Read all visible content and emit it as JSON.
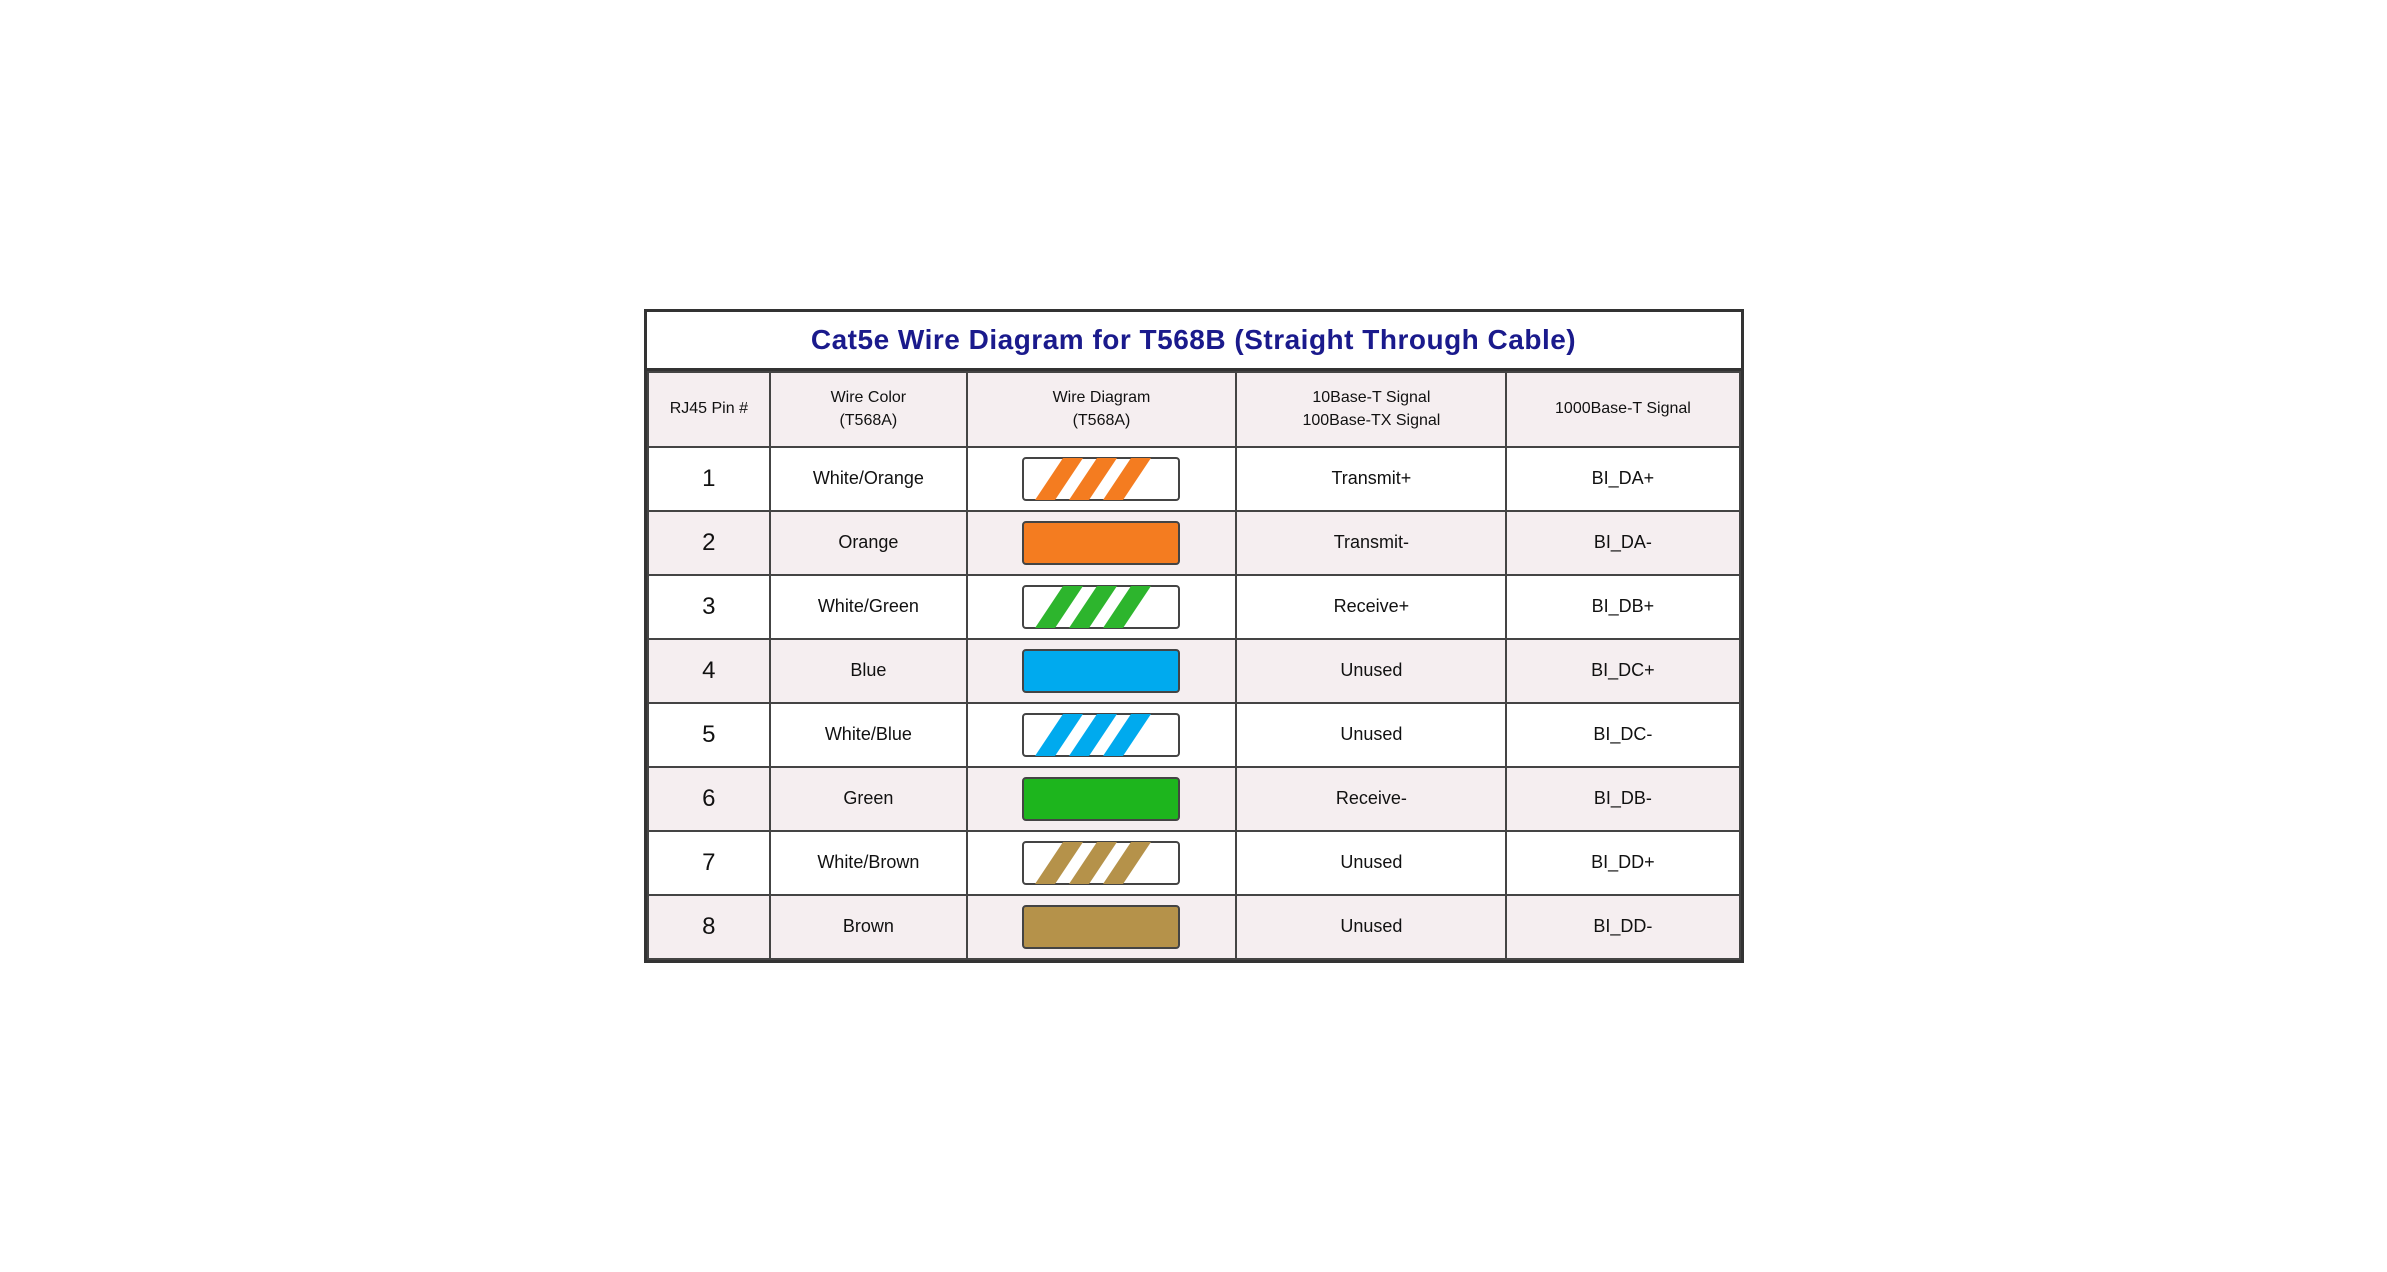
{
  "title": "Cat5e Wire Diagram for T568B (Straight Through Cable)",
  "columns": {
    "pin": "RJ45 Pin #",
    "wire_color": "Wire Color\n(T568A)",
    "wire_diagram": "Wire Diagram\n(T568A)",
    "signal_10_100": "10Base-T Signal\n100Base-TX Signal",
    "signal_1000": "1000Base-T Signal"
  },
  "rows": [
    {
      "pin": "1",
      "color": "White/Orange",
      "wire_type": "striped",
      "stripe_color": "#F47C20",
      "bg_color": "#fff",
      "signal": "Transmit+",
      "gbase": "BI_DA+"
    },
    {
      "pin": "2",
      "color": "Orange",
      "wire_type": "solid",
      "stripe_color": "#F47C20",
      "bg_color": "#F47C20",
      "signal": "Transmit-",
      "gbase": "BI_DA-"
    },
    {
      "pin": "3",
      "color": "White/Green",
      "wire_type": "striped",
      "stripe_color": "#2db52d",
      "bg_color": "#fff",
      "signal": "Receive+",
      "gbase": "BI_DB+"
    },
    {
      "pin": "4",
      "color": "Blue",
      "wire_type": "solid",
      "stripe_color": "#00AAEE",
      "bg_color": "#00AAEE",
      "signal": "Unused",
      "gbase": "BI_DC+"
    },
    {
      "pin": "5",
      "color": "White/Blue",
      "wire_type": "striped",
      "stripe_color": "#00AAEE",
      "bg_color": "#fff",
      "signal": "Unused",
      "gbase": "BI_DC-"
    },
    {
      "pin": "6",
      "color": "Green",
      "wire_type": "solid",
      "stripe_color": "#1db51d",
      "bg_color": "#1db51d",
      "signal": "Receive-",
      "gbase": "BI_DB-"
    },
    {
      "pin": "7",
      "color": "White/Brown",
      "wire_type": "striped",
      "stripe_color": "#b5924a",
      "bg_color": "#fff",
      "signal": "Unused",
      "gbase": "BI_DD+"
    },
    {
      "pin": "8",
      "color": "Brown",
      "wire_type": "solid",
      "stripe_color": "#b5924a",
      "bg_color": "#b5924a",
      "signal": "Unused",
      "gbase": "BI_DD-"
    }
  ]
}
